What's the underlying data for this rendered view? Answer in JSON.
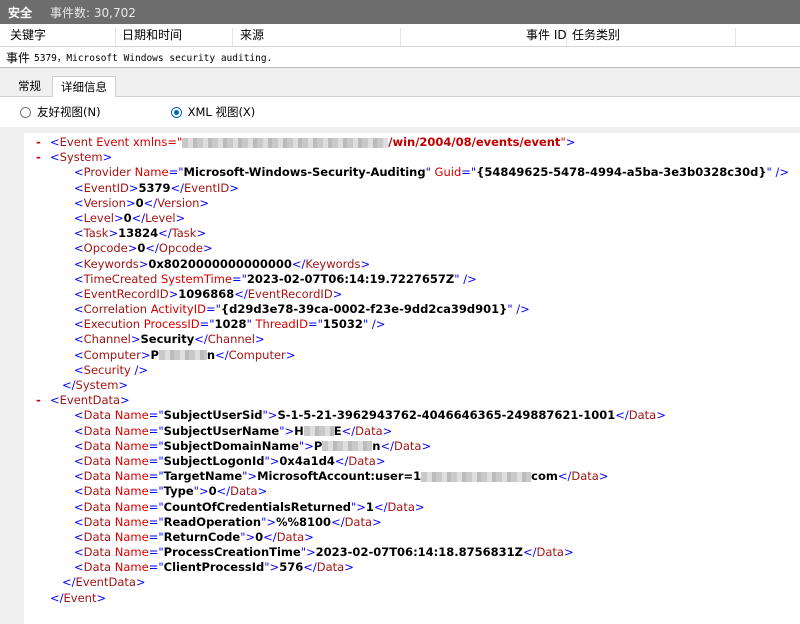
{
  "titlebar": {
    "title": "安全",
    "event_count": "事件数: 30,702"
  },
  "columns": [
    "关键字",
    "日期和时间",
    "来源",
    "事件 ID",
    "任务类别"
  ],
  "event_header": {
    "label": "事件",
    "text": "5379，Microsoft Windows security auditing."
  },
  "tabs": [
    "常规",
    "详细信息"
  ],
  "radios": {
    "friendly": "友好视图(N)",
    "xml": "XML 视图(X)"
  },
  "xml": {
    "event_open": "Event xmlns=\"",
    "ns_suffix": "/win/2004/08/events/event",
    "provider_name": "Microsoft-Windows-Security-Auditing",
    "provider_guid": "{54849625-5478-4994-a5ba-3e3b0328c30d}",
    "event_id": "5379",
    "version": "0",
    "level": "0",
    "task": "13824",
    "opcode": "0",
    "keywords": "0x8020000000000000",
    "time_created": "2023-02-07T06:14:19.7227657Z",
    "event_record_id": "1096868",
    "activity_id": "{d29d3e78-39ca-0002-f23e-9dd2ca39d901}",
    "process_id": "1028",
    "thread_id": "15032",
    "channel": "Security",
    "computer_prefix": "P",
    "computer_suffix": "n",
    "data": [
      {
        "name": "SubjectUserSid",
        "value": "S-1-5-21-3962943762-4046646365-249887621-1001"
      },
      {
        "name": "SubjectUserName",
        "value": "H",
        "value_suffix": "E"
      },
      {
        "name": "SubjectDomainName",
        "value": "P",
        "value_suffix": "n"
      },
      {
        "name": "SubjectLogonId",
        "value": "0x4a1d4"
      },
      {
        "name": "TargetName",
        "value": "MicrosoftAccount:user=1",
        "value_suffix": "com"
      },
      {
        "name": "Type",
        "value": "0"
      },
      {
        "name": "CountOfCredentialsReturned",
        "value": "1"
      },
      {
        "name": "ReadOperation",
        "value": "%%8100"
      },
      {
        "name": "ReturnCode",
        "value": "0"
      },
      {
        "name": "ProcessCreationTime",
        "value": "2023-02-07T06:14:18.8756831Z"
      },
      {
        "name": "ClientProcessId",
        "value": "576"
      }
    ]
  }
}
